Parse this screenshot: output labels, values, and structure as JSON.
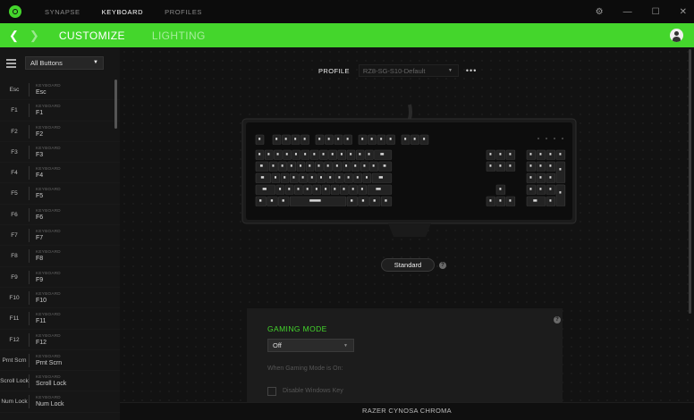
{
  "titlebar": {
    "tabs": [
      "SYNAPSE",
      "KEYBOARD",
      "PROFILES"
    ],
    "active_tab": "KEYBOARD",
    "controls": {
      "settings": "⚙",
      "minimize": "—",
      "maximize": "☐",
      "close": "✕"
    }
  },
  "nav": {
    "back": "❮",
    "forward": "❯",
    "customize": "CUSTOMIZE",
    "lighting": "LIGHTING"
  },
  "sidebar": {
    "filter_value": "All Buttons",
    "keys": [
      {
        "key": "Esc",
        "type": "KEYBOARD",
        "assignment": "Esc"
      },
      {
        "key": "F1",
        "type": "KEYBOARD",
        "assignment": "F1"
      },
      {
        "key": "F2",
        "type": "KEYBOARD",
        "assignment": "F2"
      },
      {
        "key": "F3",
        "type": "KEYBOARD",
        "assignment": "F3"
      },
      {
        "key": "F4",
        "type": "KEYBOARD",
        "assignment": "F4"
      },
      {
        "key": "F5",
        "type": "KEYBOARD",
        "assignment": "F5"
      },
      {
        "key": "F6",
        "type": "KEYBOARD",
        "assignment": "F6"
      },
      {
        "key": "F7",
        "type": "KEYBOARD",
        "assignment": "F7"
      },
      {
        "key": "F8",
        "type": "KEYBOARD",
        "assignment": "F8"
      },
      {
        "key": "F9",
        "type": "KEYBOARD",
        "assignment": "F9"
      },
      {
        "key": "F10",
        "type": "KEYBOARD",
        "assignment": "F10"
      },
      {
        "key": "F11",
        "type": "KEYBOARD",
        "assignment": "F11"
      },
      {
        "key": "F12",
        "type": "KEYBOARD",
        "assignment": "F12"
      },
      {
        "key": "Prnt Scrn",
        "type": "KEYBOARD",
        "assignment": "Prnt Scrn"
      },
      {
        "key": "Scroll Lock",
        "type": "KEYBOARD",
        "assignment": "Scroll Lock"
      },
      {
        "key": "Num Lock",
        "type": "KEYBOARD",
        "assignment": "Num Lock"
      }
    ]
  },
  "main": {
    "profile_label": "PROFILE",
    "profile_value": "RZ8-SG-S10-Default",
    "profile_more": "•••",
    "layout_button": "Standard",
    "help": "?"
  },
  "gaming_mode": {
    "title": "GAMING MODE",
    "value": "Off",
    "when_text": "When Gaming Mode is On:",
    "checkbox_label": "Disable Windows Key",
    "help": "?"
  },
  "device_name": "RAZER CYNOSA CHROMA"
}
